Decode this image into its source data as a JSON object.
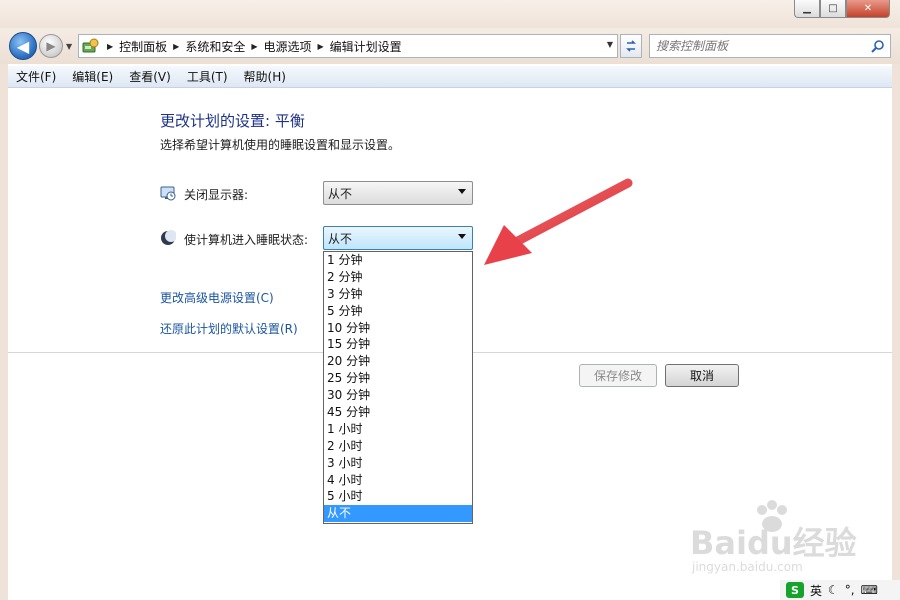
{
  "address_bar": {
    "crumbs": [
      "控制面板",
      "系统和安全",
      "电源选项",
      "编辑计划设置"
    ]
  },
  "search": {
    "placeholder": "搜索控制面板"
  },
  "menu": [
    "文件(F)",
    "编辑(E)",
    "查看(V)",
    "工具(T)",
    "帮助(H)"
  ],
  "page": {
    "title": "更改计划的设置: 平衡",
    "description": "选择希望计算机使用的睡眠设置和显示设置。"
  },
  "settings": [
    {
      "label": "关闭显示器:",
      "value": "从不",
      "icon": "display-icon"
    },
    {
      "label": "使计算机进入睡眠状态:",
      "value": "从不",
      "icon": "sleep-moon-icon"
    }
  ],
  "links": {
    "advanced": "更改高级电源设置(C)",
    "restore": "还原此计划的默认设置(R)"
  },
  "buttons": {
    "save": "保存修改",
    "cancel": "取消"
  },
  "dropdown_options": [
    "1 分钟",
    "2 分钟",
    "3 分钟",
    "5 分钟",
    "10 分钟",
    "15 分钟",
    "20 分钟",
    "25 分钟",
    "30 分钟",
    "45 分钟",
    "1 小时",
    "2 小时",
    "3 小时",
    "4 小时",
    "5 小时",
    "从不"
  ],
  "dropdown_selected_index": 15,
  "tray": {
    "ime": "英"
  },
  "watermark": {
    "brand": "Baidu经验",
    "url": "jingyan.baidu.com"
  },
  "colors": {
    "accent_arrow": "#e8414a",
    "selection": "#3399ff",
    "link": "#1a55a0",
    "title": "#1e3287"
  }
}
